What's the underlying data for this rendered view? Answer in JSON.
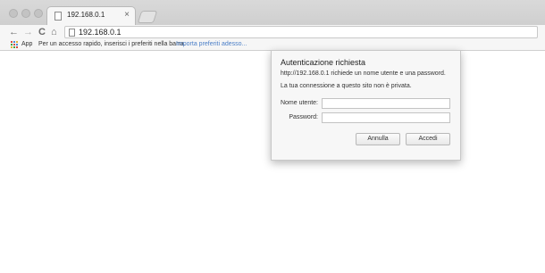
{
  "tab": {
    "title": "192.168.0.1",
    "close": "×"
  },
  "toolbar": {
    "back": "←",
    "forward": "→",
    "reload": "C",
    "home": "⌂",
    "url": "192.168.0.1"
  },
  "bookmarks": {
    "apps_label": "App",
    "hint": "Per un accesso rapido, inserisci i preferiti nella barra.",
    "import_link": "Importa preferiti adesso..."
  },
  "dialog": {
    "title": "Autenticazione richiesta",
    "message": "http://192.168.0.1 richiede un nome utente e una password.",
    "privacy_note": "La tua connessione a questo sito non è privata.",
    "username_label": "Nome utente:",
    "username_value": "",
    "password_label": "Password:",
    "password_value": "",
    "cancel_label": "Annulla",
    "login_label": "Accedi"
  }
}
